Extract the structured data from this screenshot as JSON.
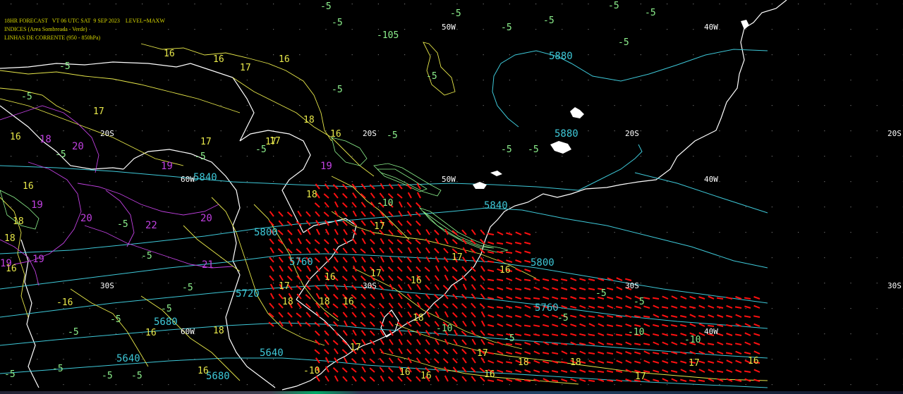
{
  "header": {
    "line1": "18HR FORECAST   VT 06 UTC SAT  9 SEP 2023    LEVEL=MAXW",
    "line2": "INDICES (Area Sombreada - Verde)",
    "line3": "LINHAS DE CORRENTE (950 - 850hPa)"
  },
  "colors": {
    "background": "#000000",
    "coast": "#ffffff",
    "heights": "#3ec8d8",
    "yellow_lines": "#e8e84a",
    "magenta_lines": "#c040e0",
    "green_index": "#8cf08c",
    "wind_barbs": "#ff1010",
    "grid_dots": "#6a6a6a"
  },
  "grid_labels": [
    "50W",
    "40W",
    "60W",
    "20S",
    "30S",
    "20S",
    "30S",
    "20S",
    "30S"
  ],
  "cyan_labels": [
    "5880",
    "5880",
    "5840",
    "5840",
    "5800",
    "5800",
    "5760",
    "5760",
    "5720",
    "5680",
    "5640",
    "5640",
    "5680"
  ],
  "yellow_labels": [
    "16",
    "16",
    "17",
    "16",
    "17",
    "18",
    "16",
    "17",
    "17",
    "16",
    "18",
    "17",
    "17",
    "16",
    "16",
    "18",
    "17",
    "17",
    "16",
    "18",
    "16",
    "17",
    "18",
    "16",
    "18",
    "18",
    "17",
    "16",
    "16",
    "16",
    "17",
    "16",
    "17",
    "-10",
    "18",
    "18",
    "17",
    "16",
    "16",
    "-16",
    "16",
    "18"
  ],
  "magenta_labels": [
    "18",
    "20",
    "19",
    "19",
    "19",
    "20",
    "22",
    "20",
    "21",
    "19",
    "19"
  ],
  "green_labels": [
    "-5",
    "-5",
    "-5",
    "-5",
    "-5",
    "-5",
    "-5",
    "-5",
    "-5",
    "-5",
    "-5",
    "-5",
    "-5",
    "-5",
    "-5",
    "-5",
    "-5",
    "-5",
    "-5",
    "-5",
    "-5",
    "-5",
    "-5",
    "-5",
    "-5",
    "-5",
    "-5",
    "-5",
    "-105",
    "-10",
    "-10",
    "-10",
    "-10",
    "-5",
    "-5",
    "-5",
    "-5"
  ]
}
